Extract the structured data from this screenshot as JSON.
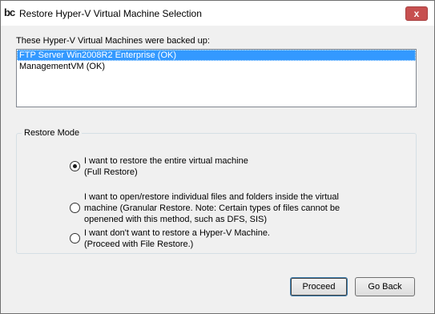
{
  "window": {
    "app_icon": "bc",
    "title": "Restore Hyper-V Virtual Machine Selection",
    "close_glyph": "x"
  },
  "vm_list": {
    "caption": "These Hyper-V Virtual Machines were backed up:",
    "items": [
      {
        "label": "FTP Server Win2008R2 Enterprise (OK)",
        "selected": true
      },
      {
        "label": "ManagementVM (OK)",
        "selected": false
      }
    ]
  },
  "restore_mode": {
    "title": "Restore Mode",
    "options": [
      {
        "line1": "I want to restore the entire virtual machine",
        "line2": "(Full Restore)",
        "line3": "",
        "checked": true
      },
      {
        "line1": "I want to open/restore individual files and folders inside the virtual",
        "line2": "machine (Granular Restore. Note: Certain types of files cannot be",
        "line3": "openened with this method, such as DFS, SIS)",
        "checked": false
      },
      {
        "line1": "I want don't want to restore a Hyper-V Machine.",
        "line2": "(Proceed with File Restore.)",
        "line3": "",
        "checked": false
      }
    ]
  },
  "buttons": {
    "proceed": "Proceed",
    "go_back": "Go Back"
  }
}
